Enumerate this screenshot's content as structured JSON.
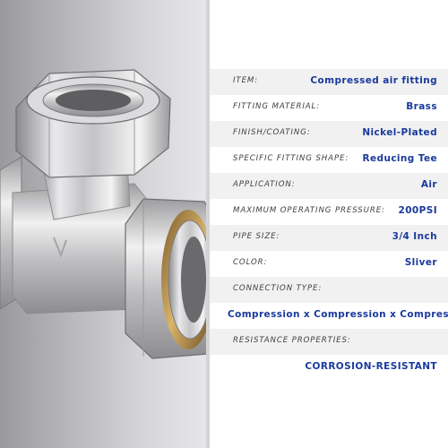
{
  "specs": [
    {
      "label": "ITEM:",
      "value": "Compressed air fitting"
    },
    {
      "label": "FITTING MATERIAL:",
      "value": "Brass"
    },
    {
      "label": "FINISH/COATING:",
      "value": "Nickel-Plated"
    },
    {
      "label": "SPECIFIC FITTING SHAPE:",
      "value": "Reducing Tee"
    },
    {
      "label": "APPLICATION:",
      "value": "Air"
    },
    {
      "label": "MAXIMUM OPERATING PRESSURE:",
      "value": "200PSI"
    },
    {
      "label": "PIPE SIZE:",
      "value": "3/4 Inch"
    },
    {
      "label": "COLOR:",
      "value": "Sliver"
    },
    {
      "label": "CONNECTION TYPE:",
      "value": ""
    },
    {
      "label": "",
      "value": "Compression x Compression x Compression"
    },
    {
      "label": "RESISTANCE PROPERTIES:",
      "value": ""
    },
    {
      "label": "",
      "value": "CORROSION-RESISTANT"
    }
  ],
  "colors": {
    "value_text": "#1a3a9c",
    "label_text": "#3f3f3f",
    "row_shade": "#f1f1f2"
  }
}
